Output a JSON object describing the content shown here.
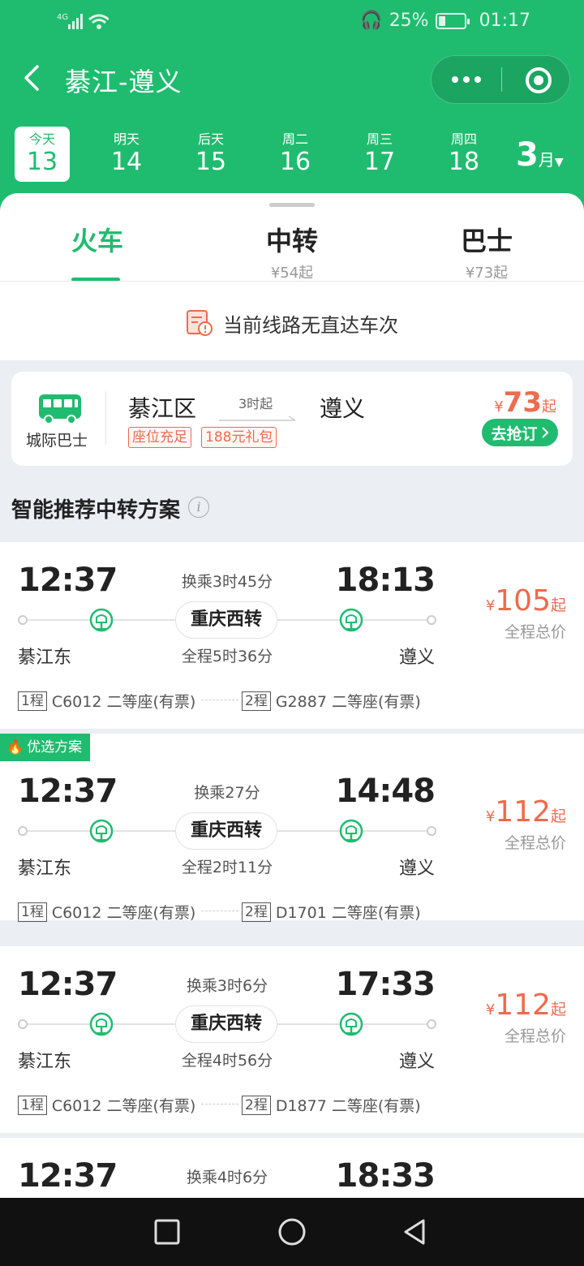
{
  "status": {
    "network": "4G",
    "battery_pct": "25%",
    "battery_level": 0.25,
    "time": "01:17"
  },
  "nav": {
    "title": "綦江-遵义"
  },
  "dates": [
    {
      "label": "今天",
      "day": "13"
    },
    {
      "label": "明天",
      "day": "14"
    },
    {
      "label": "后天",
      "day": "15"
    },
    {
      "label": "周二",
      "day": "16"
    },
    {
      "label": "周三",
      "day": "17"
    },
    {
      "label": "周四",
      "day": "18"
    }
  ],
  "month": {
    "num": "3",
    "unit": "月"
  },
  "tabs": [
    {
      "label": "火车",
      "sub": ""
    },
    {
      "label": "中转",
      "sub": "¥54起"
    },
    {
      "label": "巴士",
      "sub": "¥73起"
    }
  ],
  "notice": "当前线路无直达车次",
  "bus": {
    "label": "城际巴士",
    "from": "綦江区",
    "duration": "3时起",
    "to": "遵义",
    "tags": [
      "座位充足",
      "188元礼包"
    ],
    "currency": "¥",
    "price": "73",
    "price_suffix": "起",
    "button": "去抢订"
  },
  "section_title": "智能推荐中转方案",
  "info_icon": "i",
  "routes": [
    {
      "badge": "",
      "dep": "12:37",
      "arr": "18:13",
      "transfer": "换乘3时45分",
      "hub": "重庆西转",
      "from": "綦江东",
      "to": "遵义",
      "total": "全程5时36分",
      "seg1_no": "1程",
      "seg1": "C6012 二等座(有票)",
      "seg2_no": "2程",
      "seg2": "G2887 二等座(有票)",
      "currency": "¥",
      "price": "105",
      "suffix": "起",
      "total_label": "全程总价"
    },
    {
      "badge": "优选方案",
      "dep": "12:37",
      "arr": "14:48",
      "transfer": "换乘27分",
      "hub": "重庆西转",
      "from": "綦江东",
      "to": "遵义",
      "total": "全程2时11分",
      "seg1_no": "1程",
      "seg1": "C6012 二等座(有票)",
      "seg2_no": "2程",
      "seg2": "D1701 二等座(有票)",
      "currency": "¥",
      "price": "112",
      "suffix": "起",
      "total_label": "全程总价"
    },
    {
      "badge": "",
      "dep": "12:37",
      "arr": "17:33",
      "transfer": "换乘3时6分",
      "hub": "重庆西转",
      "from": "綦江东",
      "to": "遵义",
      "total": "全程4时56分",
      "seg1_no": "1程",
      "seg1": "C6012 二等座(有票)",
      "seg2_no": "2程",
      "seg2": "D1877 二等座(有票)",
      "currency": "¥",
      "price": "112",
      "suffix": "起",
      "total_label": "全程总价"
    },
    {
      "badge": "",
      "dep": "12:37",
      "arr": "18:33",
      "transfer": "换乘4时6分",
      "hub": "",
      "from": "",
      "to": "",
      "total": "",
      "seg1_no": "",
      "seg1": "",
      "seg2_no": "",
      "seg2": "",
      "currency": "",
      "price": "",
      "suffix": "",
      "total_label": ""
    }
  ],
  "colors": {
    "brand": "#1fbc6f",
    "price": "#ee6b4d",
    "bg": "#ebeef3"
  },
  "icons": [
    "signal-icon",
    "wifi-icon",
    "headset-icon",
    "battery-icon",
    "back-arrow-icon",
    "more-icon",
    "close-circle-icon",
    "caret-down-icon",
    "no-ticket-icon",
    "bus-icon",
    "info-icon",
    "train-icon",
    "fire-icon",
    "nav-square-icon",
    "nav-circle-icon",
    "nav-back-icon"
  ]
}
